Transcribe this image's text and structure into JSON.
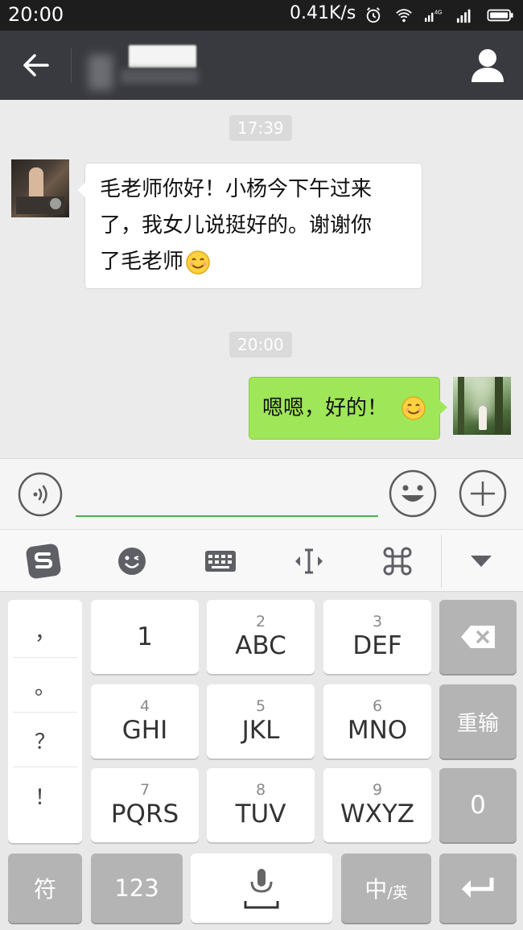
{
  "status_bar": {
    "time": "20:00",
    "network_speed": "0.41K/s",
    "icons": [
      "alarm-icon",
      "wifi-icon",
      "signal-4g-icon",
      "signal-icon",
      "battery-icon"
    ],
    "network_type": "4G"
  },
  "header": {
    "back_icon": "back-arrow-icon",
    "profile_icon": "person-icon"
  },
  "chat": {
    "messages": [
      {
        "type": "timestamp",
        "text": "17:39"
      },
      {
        "type": "received",
        "text": "毛老师你好！小杨今下午过来了，我女儿说挺好的。谢谢你了毛老师",
        "lines": [
          "毛老师你好！小杨今下午过来",
          "了，我女儿说挺好的。谢谢你",
          "了毛老师"
        ],
        "emoji": "smile-emoji"
      },
      {
        "type": "timestamp",
        "text": "20:00"
      },
      {
        "type": "sent",
        "text": "嗯嗯，好的！",
        "emoji": "smile-emoji"
      }
    ]
  },
  "input_bar": {
    "voice_icon": "voice-icon",
    "text_value": "",
    "emoji_icon": "emoji-icon",
    "plus_icon": "plus-icon"
  },
  "ime_toolbar": {
    "tools": [
      "sogou-logo-icon",
      "emoji-face-icon",
      "keyboard-icon",
      "cursor-icon",
      "command-icon",
      "collapse-down-icon"
    ]
  },
  "keyboard": {
    "punctuation": [
      "，",
      "。",
      "？",
      "！"
    ],
    "keys": [
      {
        "num": "",
        "letters": "1"
      },
      {
        "num": "2",
        "letters": "ABC"
      },
      {
        "num": "3",
        "letters": "DEF"
      },
      {
        "num": "4",
        "letters": "GHI"
      },
      {
        "num": "5",
        "letters": "JKL"
      },
      {
        "num": "6",
        "letters": "MNO"
      },
      {
        "num": "7",
        "letters": "PQRS"
      },
      {
        "num": "8",
        "letters": "TUV"
      },
      {
        "num": "9",
        "letters": "WXYZ"
      }
    ],
    "right_keys": {
      "delete_icon": "backspace-icon",
      "reinput": "重输",
      "zero": "0"
    },
    "bottom_row": {
      "symbols": "符",
      "numbers": "123",
      "voice_icon": "mic-icon",
      "lang_main": "中",
      "lang_sub": "/英",
      "enter_icon": "enter-icon"
    }
  },
  "colors": {
    "header_bg": "#393a3f",
    "chat_bg": "#ebebeb",
    "sent_bubble": "#9fe658",
    "input_underline": "#44b549",
    "dark_key": "#b4b4b4"
  }
}
